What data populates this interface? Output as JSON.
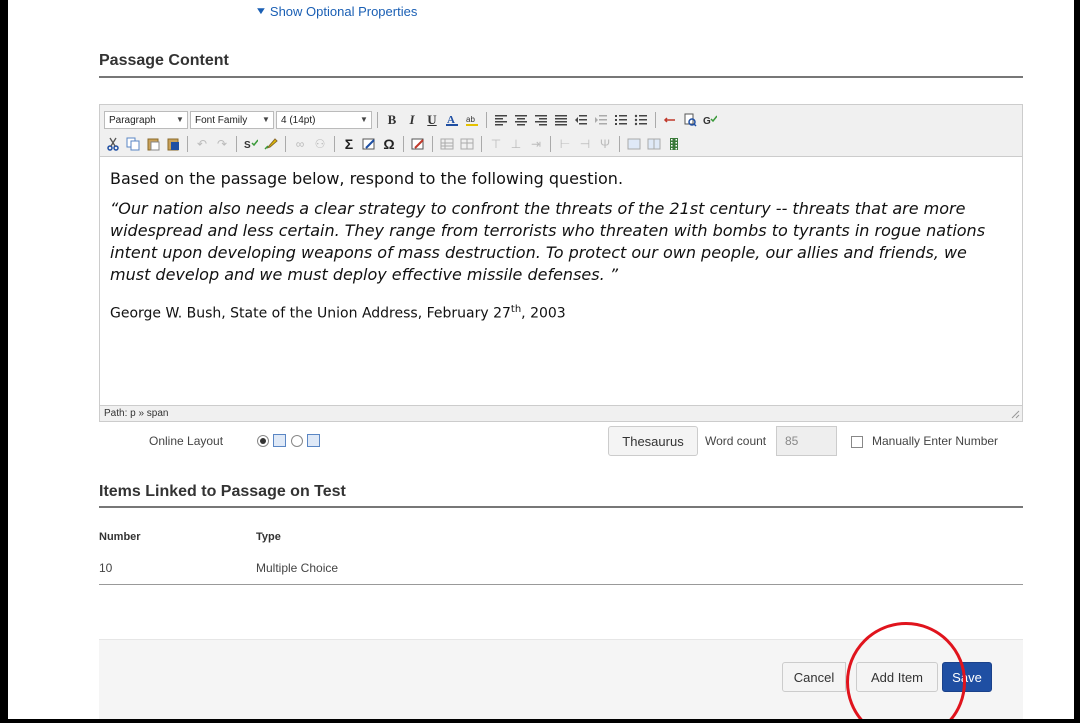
{
  "show_optional": {
    "label": "Show Optional Properties"
  },
  "passage": {
    "section_title": "Passage Content",
    "toolbar": {
      "format_select": "Paragraph",
      "font_family_select": "Font Family",
      "font_size_select": "4 (14pt)",
      "bold": "B",
      "italic": "I",
      "underline": "U"
    },
    "content": {
      "lead": "Based on the passage below, respond to the following question.",
      "quote": "“Our nation also needs a clear strategy to confront the threats of the 21st century -- threats that are more widespread and less certain. They range from terrorists who threaten with bombs to tyrants in rogue nations intent upon developing weapons of mass destruction. To protect our own people, our allies and friends, we must develop and we must deploy effective missile defenses. ”",
      "cite_before": "George W. Bush, State of the Union Address, February 27",
      "cite_sup": "th",
      "cite_after": ", 2003"
    },
    "status_path": "Path: p » span"
  },
  "layout_row": {
    "online_layout_label": "Online Layout",
    "selected_layout": "single-column",
    "thesaurus_label": "Thesaurus",
    "word_count_label": "Word count",
    "word_count_value": "85",
    "manual_label": "Manually Enter Number"
  },
  "linked_items": {
    "section_title": "Items Linked to Passage on Test",
    "columns": [
      "Number",
      "Type"
    ],
    "rows": [
      {
        "number": "10",
        "type": "Multiple Choice"
      }
    ]
  },
  "footer": {
    "cancel_label": "Cancel",
    "add_item_label": "Add Item",
    "save_label": "Save"
  },
  "colors": {
    "accent_blue": "#1f4fa3",
    "highlight_red": "#e0141d"
  }
}
